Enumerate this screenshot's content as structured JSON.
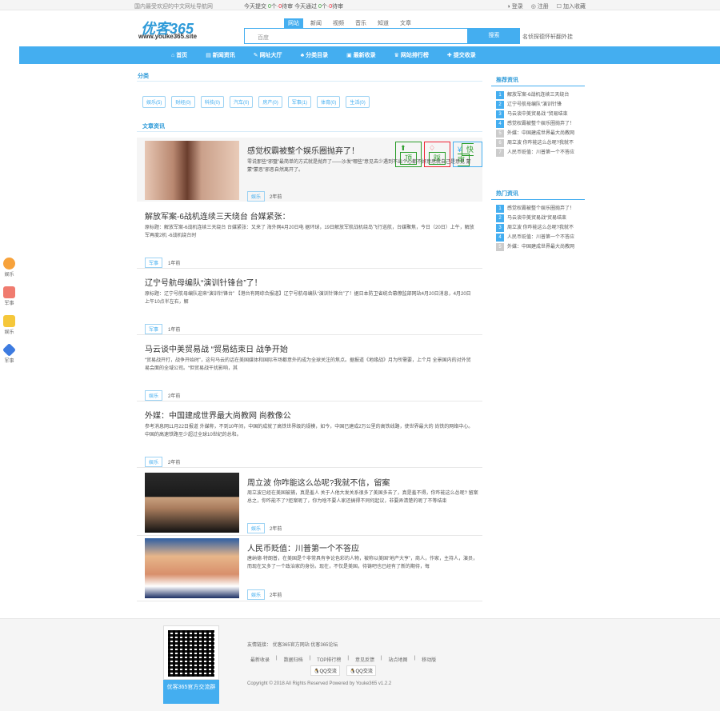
{
  "topbar": {
    "left": "国内最受欢迎的中文网址导航网",
    "stats": {
      "a": "今天提交",
      "b": "0",
      "c": "个·",
      "d": "0",
      "e": "待审",
      "f": "今天通过",
      "g": "0",
      "h": "个·",
      "i": "0",
      "j": "待审"
    },
    "login": "登录",
    "register": "注册",
    "fav": "加入收藏"
  },
  "logo": {
    "text": "优客365",
    "url": "www.youke365.site"
  },
  "search": {
    "tabs": [
      "网站",
      "新闻",
      "视频",
      "音乐",
      "知道",
      "文章"
    ],
    "placeholder": "百度",
    "button": "搜索",
    "hot": "名侦探德怀轩翻外挂"
  },
  "nav": [
    "首页",
    "新闻资讯",
    "网址大厅",
    "分类目录",
    "最新收录",
    "网站排行榜",
    "提交收录"
  ],
  "sections": {
    "category": "分类",
    "articles": "文章资讯",
    "recommended": "推荐资讯",
    "hot": "热门资讯"
  },
  "categories": [
    "娱乐(5)",
    "财经(0)",
    "科技(0)",
    "汽车(0)",
    "房产(0)",
    "军事(1)",
    "体育(0)",
    "生活(0)"
  ],
  "featured": {
    "title": "感觉权霸被整个娱乐圈抛弃了！",
    "desc": "零说那些“邪璧”最简单的方式就是抛弃了——沙发“哪些”意见去少遇到不出个心都不好意思就自己是意见 蒙蒙“蒙恶”邪恶自然离开了。",
    "tag": "娱乐",
    "time": "2年前",
    "btn_top": "顶",
    "btn_down": "踩",
    "btn_share": "快审"
  },
  "articles": [
    {
      "title": "解放军案-6战机连续三天绕台 台媒紧张：",
      "desc": "原标题：解放军案-6战机连续三天绕台 台媒紧张：又来了 海外网4月20日电 据环球，19日解放军航战机绕岛飞行巡航，台媒聚焦，今日（20日）上午，解放军再度2机 -6战机绕台时",
      "tag": "军事",
      "time": "1年前"
    },
    {
      "title": "辽宁号航母编队“演训针锋台”了！",
      "desc": "原标题：辽宁号航母编队迎来“演训针锋台” 【港台有网综合报道】辽宁号航母编队“演训针锋台”了！据日本防卫省统合幕僚监部网站4月20日消息，4月20日上午10点半左右，解",
      "tag": "军事",
      "time": "1年前"
    },
    {
      "title": "马云谈中美贸易战 “贸易结束日 战争开始",
      "desc": "“贸易战开打，战争开始时”，这句马云的话在美国媒体和国际市场都意外的成为全球关注的焦点。据报道《地缘战》月为所需要，上个月 全景国内的对外贸易会面的全域公司。“但贸易战干扰影响，其",
      "tag": "娱乐",
      "time": "2年前"
    },
    {
      "title": "外媒：中国建成世界最大尚教网 尚教像公",
      "desc": "参考消息网11月22日报道 外媒称，不到10年间，中国的成就了高铁世界级的规模，如今，中国已建成2万公里的高铁线路，使世界最大的 尚铁的网络中心。中国的高速铁路至少超过全球10世纪的总和。",
      "tag": "娱乐",
      "time": "2年前"
    },
    {
      "title": "周立波 你咋能这么怂呢?我就不信，留案",
      "desc": "周立波已经在美国被捕，真是羞人 关于人他大发关系很多了美国多去了，真是羞不得，你咋能这么怂呢? 留案 总之，你咋能不了?拒案呢了，你为啥不要人家还搞得不同何起议，非要弄清楚的呢了不等结束",
      "tag": "娱乐",
      "time": "2年前"
    },
    {
      "title": "人民币贬值：川普第一个不答应",
      "desc": "唐纳德·特朗普，在美国是个非常具有争论色彩的人物，被称以美国“地产大亨”，商人，作家，主持人，演员，而现在又多了一个政治家的身份。现在，不仅是美国，待铸吧也已经有了新的期待，每",
      "tag": "娱乐",
      "time": "2年前"
    }
  ],
  "recommended": [
    "解放军案-6战机连续三天绕台",
    "辽宁号航母编队“演训针锋",
    "马云谈中美贸易战 “贸易结束",
    "感觉权霸被整个娱乐圈抛弃了！",
    "外媒：中国建成世界最大尚教网",
    "周立波 你咋能这么怂呢?我就不",
    "人民币贬值：川普第一个不答应"
  ],
  "hotnews": [
    "感觉权霸被整个娱乐圈抛弃了！",
    "马云谈中美贸易战“贸易结束",
    "周立波 你咋能这么怂呢?我就不",
    "人民币贬值：川普第一个不答应",
    "外媒：中国建成世界最大尚教网"
  ],
  "float": [
    "娱乐",
    "军事",
    "娱乐",
    "军事"
  ],
  "footer": {
    "qr_label": "优客365官方交流群",
    "links_label": "友情链接：",
    "links": [
      "优客365官方网站",
      "优客365论坛"
    ],
    "bottom_links": [
      "最新收录",
      "数据归档",
      "TOP排行榜",
      "意见反馈",
      "站点地图",
      "移动版"
    ],
    "qq1": "QQ交流",
    "qq2": "QQ交流",
    "copyright": "Copyright © 2018 All Rights Reserved Powered by Youke365 v1.2.2"
  },
  "colors": {
    "accent": "#44aef0",
    "green": "#2a9d2a",
    "red": "#e23"
  }
}
